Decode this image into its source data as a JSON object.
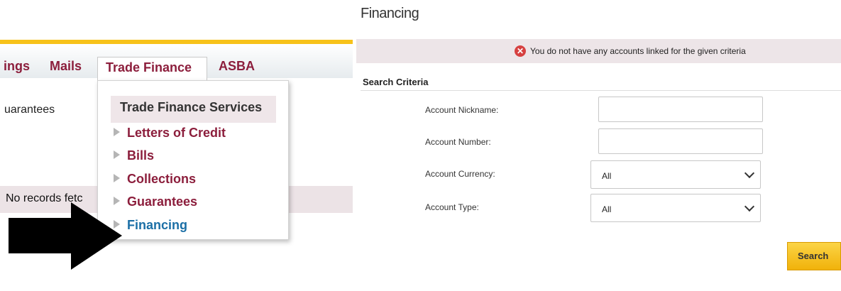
{
  "colors": {
    "accent_yellow": "#f7c21a",
    "brand_maroon": "#8c1e3c",
    "link_blue": "#1b6fa6",
    "error_red": "#d64040"
  },
  "left": {
    "nav": {
      "items": [
        "ings",
        "Mails",
        "Trade Finance",
        "ASBA"
      ],
      "active_index": 2
    },
    "guarantees_text": "uarantees",
    "records_text": "No records fetc",
    "menu": {
      "header": "Trade Finance Services",
      "items": [
        "Letters of Credit",
        "Bills",
        "Collections",
        "Guarantees",
        "Financing"
      ],
      "active_index": 4,
      "bullet_icon": "triangle-right-icon"
    },
    "arrow_icon": "arrow-right-icon"
  },
  "right": {
    "title": "Financing",
    "error": {
      "icon": "error-x-icon",
      "text": "You do not have any accounts linked for the given criteria"
    },
    "criteria_label": "Search Criteria",
    "fields": [
      {
        "label": "Account Nickname:",
        "value": ""
      },
      {
        "label": "Account Number:",
        "value": ""
      },
      {
        "label": "Account Currency:",
        "value": "All"
      },
      {
        "label": "Account Type:",
        "value": "All"
      }
    ],
    "search_label": "Search"
  }
}
